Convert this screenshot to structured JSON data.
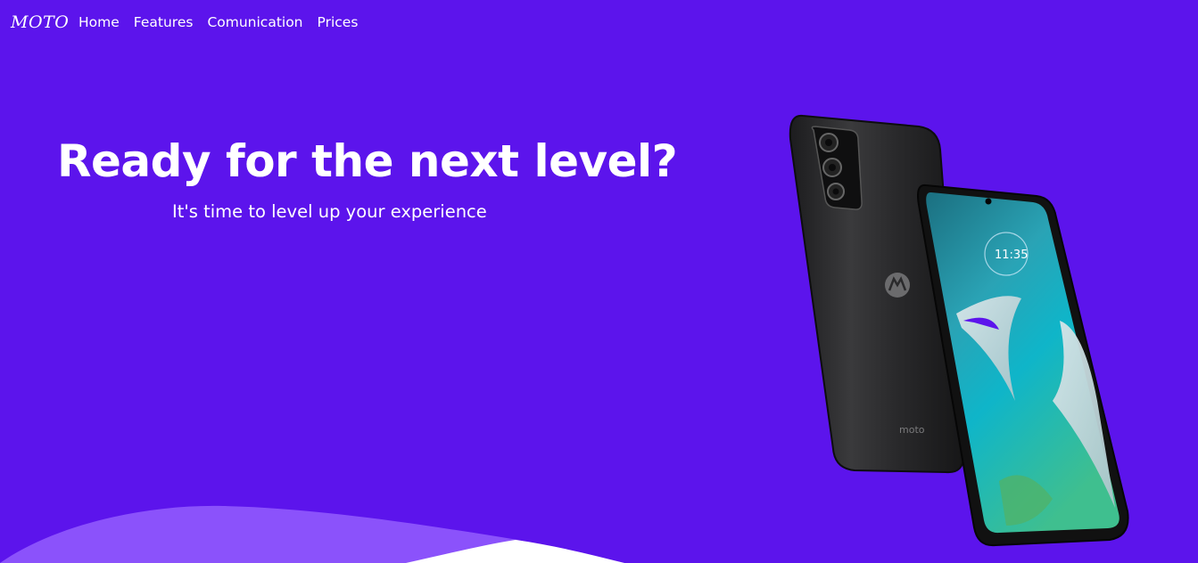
{
  "nav": {
    "logo": "MOTO",
    "links": [
      "Home",
      "Features",
      "Comunication",
      "Prices"
    ]
  },
  "hero": {
    "title": "Ready for the next level?",
    "subtitle": "It's time to level up your experience"
  },
  "phone": {
    "back_brand": "motorola",
    "clock_time": "11:35"
  },
  "colors": {
    "background": "#5c14ec",
    "wave_light": "#8b52fb",
    "wave_white": "#ffffff",
    "text": "#ffffff"
  },
  "icons": [
    "motorola-logo-icon",
    "camera-module-icon"
  ]
}
